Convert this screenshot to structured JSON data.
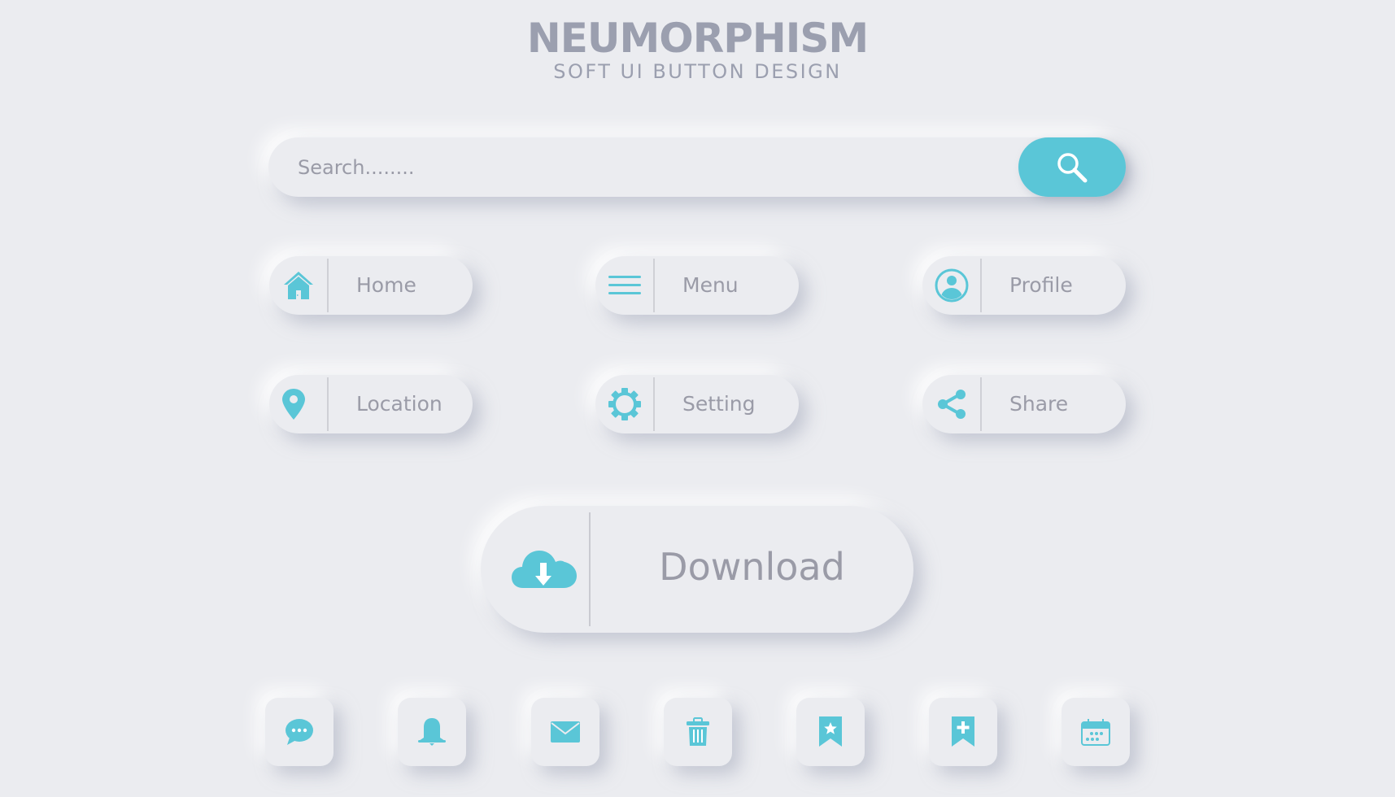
{
  "header": {
    "title": "NEUMORPHISM",
    "subtitle": "SOFT UI BUTTON DESIGN"
  },
  "search": {
    "placeholder": "Search........",
    "value": "",
    "button_icon": "search-icon"
  },
  "colors": {
    "background": "#ebecf0",
    "accent": "#5ac6d7",
    "text": "#9a9ba7",
    "title": "#9b9faf"
  },
  "buttons": [
    {
      "label": "Home",
      "icon": "home-icon"
    },
    {
      "label": "Menu",
      "icon": "menu-icon"
    },
    {
      "label": "Profile",
      "icon": "profile-icon"
    },
    {
      "label": "Location",
      "icon": "location-pin-icon"
    },
    {
      "label": "Setting",
      "icon": "gear-icon"
    },
    {
      "label": "Share",
      "icon": "share-icon"
    }
  ],
  "download": {
    "label": "Download",
    "icon": "cloud-download-icon"
  },
  "icon_buttons": [
    {
      "name": "chat",
      "icon": "chat-bubble-icon"
    },
    {
      "name": "notifications",
      "icon": "bell-icon"
    },
    {
      "name": "mail",
      "icon": "envelope-icon"
    },
    {
      "name": "delete",
      "icon": "trash-icon"
    },
    {
      "name": "favorite-bookmark",
      "icon": "bookmark-star-icon"
    },
    {
      "name": "add-bookmark",
      "icon": "bookmark-plus-icon"
    },
    {
      "name": "calendar",
      "icon": "calendar-icon"
    }
  ]
}
